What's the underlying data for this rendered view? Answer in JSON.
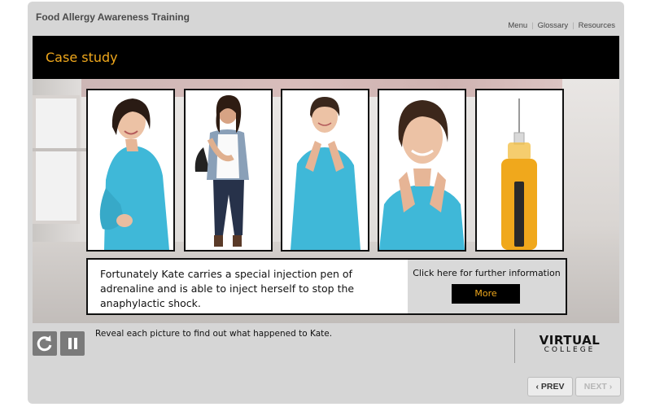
{
  "app": {
    "title": "Food Allergy Awareness Training"
  },
  "topnav": {
    "menu": "Menu",
    "glossary": "Glossary",
    "resources": "Resources"
  },
  "header": {
    "title": "Case study"
  },
  "cards": [
    {
      "name": "woman-smiling-photo"
    },
    {
      "name": "teen-with-backpack-photo"
    },
    {
      "name": "woman-itchy-neck-photo"
    },
    {
      "name": "woman-distressed-photo"
    },
    {
      "name": "adrenaline-pen-photo"
    }
  ],
  "info": {
    "text": "Fortunately Kate carries a special injection pen of adrenaline and is able to inject herself to stop the anaphylactic shock.",
    "cta": "Click here for further information",
    "more": "More"
  },
  "controls": {
    "replay_icon": "replay-icon",
    "pause_icon": "pause-icon",
    "instruction": "Reveal each picture to find out what happened to Kate."
  },
  "logo": {
    "line1": "VIRTUAL",
    "line2": "COLLEGE"
  },
  "nav": {
    "prev": "PREV",
    "next": "NEXT",
    "prev_icon": "chevron-left-icon",
    "next_icon": "chevron-right-icon"
  },
  "colors": {
    "accent": "#f0a81c",
    "header_bg": "#000000",
    "frame_bg": "#d6d6d6",
    "shirt": "#3fb8d8"
  }
}
